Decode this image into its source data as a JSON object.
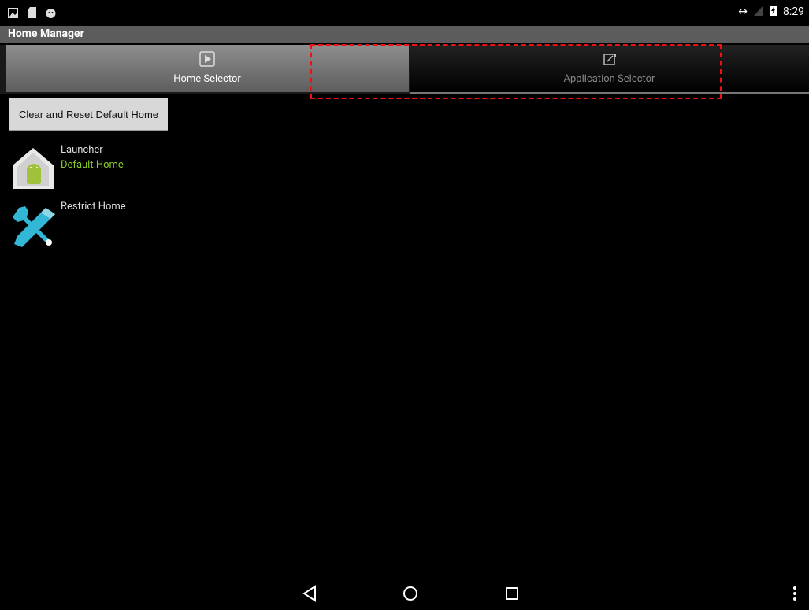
{
  "statusbar": {
    "time": "8:29",
    "left_icons": [
      "image-icon",
      "sd-card-icon",
      "android-icon"
    ],
    "right_icons": [
      "data-arrows-icon",
      "signal-icon",
      "battery-charging-icon"
    ]
  },
  "app": {
    "title": "Home Manager"
  },
  "tabs": [
    {
      "label": "Home Selector",
      "icon": "play-square-icon",
      "selected": true
    },
    {
      "label": "Application Selector",
      "icon": "share-square-icon",
      "selected": false
    }
  ],
  "reset_button": {
    "label": "Clear and Reset Default Home"
  },
  "list": [
    {
      "title": "Launcher",
      "subtitle": "Default Home",
      "icon": "home-android-icon"
    },
    {
      "title": "Restrict Home",
      "subtitle": "",
      "icon": "wrench-screwdriver-icon"
    }
  ],
  "navbar": {
    "buttons": [
      "back-icon",
      "home-icon",
      "recents-icon",
      "menu-icon"
    ]
  },
  "colors": {
    "accent_green": "#8ccc2a",
    "annotation": "#e11111"
  }
}
